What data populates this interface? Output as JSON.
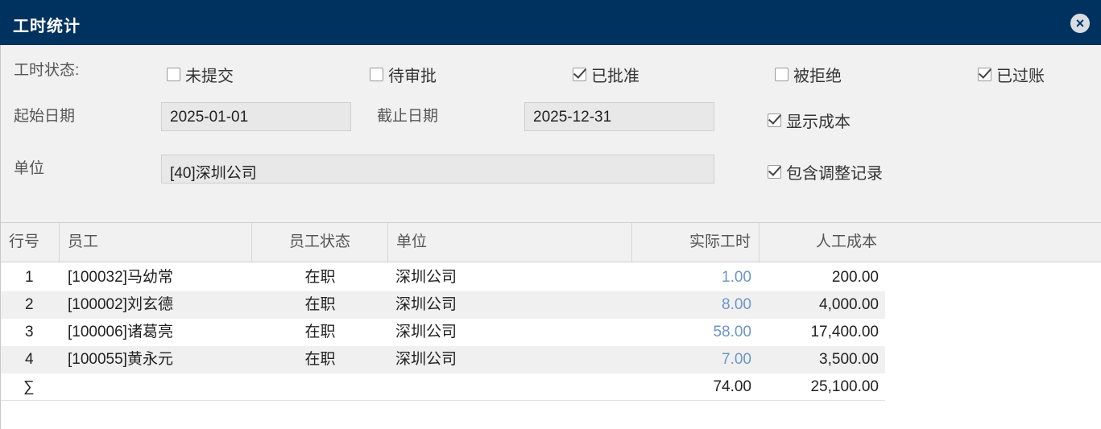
{
  "window": {
    "title": "工时统计",
    "close_icon": "×"
  },
  "filters": {
    "status_label": "工时状态:",
    "statuses": [
      {
        "label": "未提交",
        "checked": false
      },
      {
        "label": "待审批",
        "checked": false
      },
      {
        "label": "已批准",
        "checked": true
      },
      {
        "label": "被拒绝",
        "checked": false
      },
      {
        "label": "已过账",
        "checked": true
      }
    ],
    "start_label": "起始日期",
    "start_value": "2025-01-01",
    "end_label": "截止日期",
    "end_value": "2025-12-31",
    "show_cost_label": "显示成本",
    "show_cost_checked": true,
    "unit_label": "单位",
    "unit_value": "[40]深圳公司",
    "include_adj_label": "包含调整记录",
    "include_adj_checked": true
  },
  "table": {
    "headers": [
      "行号",
      "员工",
      "员工状态",
      "单位",
      "实际工时",
      "人工成本"
    ],
    "rows": [
      {
        "no": "1",
        "employee": "[100032]马幼常",
        "status": "在职",
        "unit": "深圳公司",
        "hours": "1.00",
        "cost": "200.00"
      },
      {
        "no": "2",
        "employee": "[100002]刘玄德",
        "status": "在职",
        "unit": "深圳公司",
        "hours": "8.00",
        "cost": "4,000.00"
      },
      {
        "no": "3",
        "employee": "[100006]诸葛亮",
        "status": "在职",
        "unit": "深圳公司",
        "hours": "58.00",
        "cost": "17,400.00"
      },
      {
        "no": "4",
        "employee": "[100055]黄永元",
        "status": "在职",
        "unit": "深圳公司",
        "hours": "7.00",
        "cost": "3,500.00"
      }
    ],
    "total": {
      "symbol": "∑",
      "hours": "74.00",
      "cost": "25,100.00"
    }
  }
}
